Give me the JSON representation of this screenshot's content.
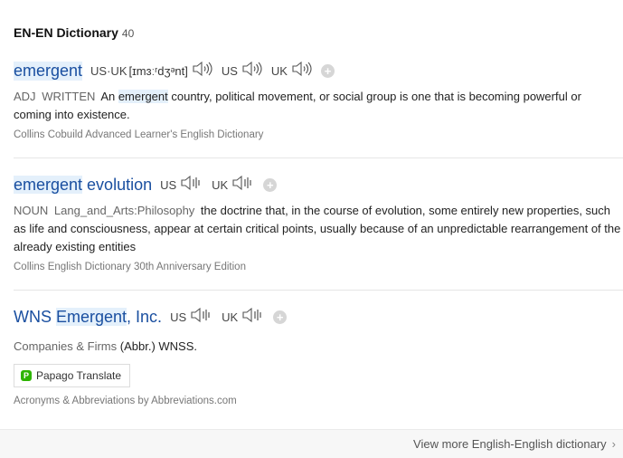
{
  "section": {
    "title": "EN-EN Dictionary",
    "count": "40"
  },
  "entries": [
    {
      "headword_parts": [
        "emergent"
      ],
      "pron_label": "US·UK",
      "pron": "[ɪmɜːʳdʒᵊnt]",
      "audio": [
        "US",
        "UK"
      ],
      "def_pos": "ADJ",
      "def_tag": "WRITTEN",
      "def_parts": [
        "An ",
        "emergent",
        " country, political movement, or social group is one that is becoming powerful or coming into existence."
      ],
      "source": "Collins Cobuild Advanced Learner's English Dictionary"
    },
    {
      "headword_parts": [
        "emergent",
        " evolution"
      ],
      "audio": [
        "US",
        "UK"
      ],
      "def_pos": "NOUN",
      "def_tag": "Lang_and_Arts:Philosophy",
      "definition": "the doctrine that, in the course of evolution, some entirely new properties, such as life and consciousness, appear at certain critical points, usually because of an unpredictable rearrangement of the already existing entities",
      "source": "Collins English Dictionary 30th Anniversary Edition"
    },
    {
      "headword_parts": [
        "WNS ",
        "Emergent",
        ", Inc."
      ],
      "audio": [
        "US",
        "UK"
      ],
      "category": "Companies & Firms",
      "definition": "(Abbr.) WNSS.",
      "translate_label": "Papago Translate",
      "source": "Acronyms & Abbreviations by Abbreviations.com"
    }
  ],
  "footer": {
    "more_label": "View more English-English dictionary"
  },
  "icons": {
    "speaker": "speaker-icon",
    "add": "plus-icon",
    "translate": "papago-icon",
    "chevron": "chevron-right-icon"
  }
}
